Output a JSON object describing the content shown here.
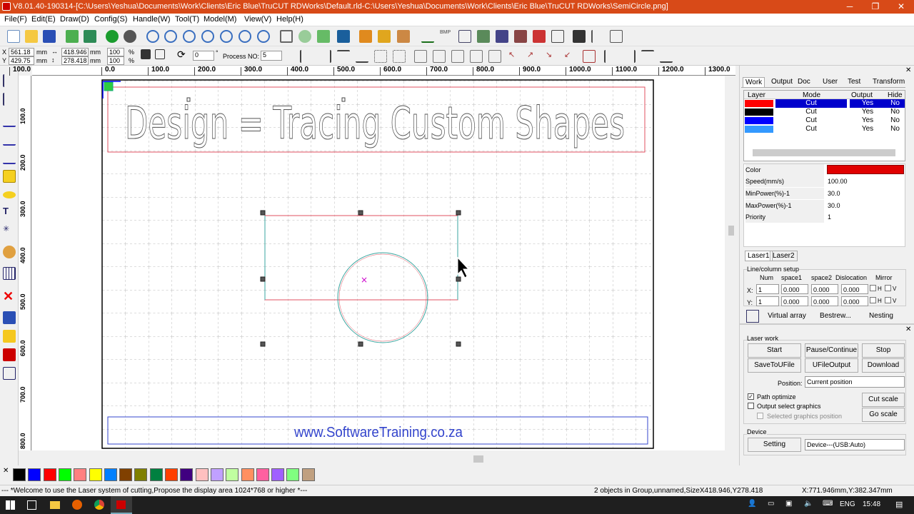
{
  "window": {
    "title": "V8.01.40-190314-[C:\\Users\\Yeshua\\Documents\\Work\\Clients\\Eric Blue\\TruCUT RDWorks\\Default.rld-C:\\Users\\Yeshua\\Documents\\Work\\Clients\\Eric Blue\\TruCUT RDWorks\\SemiCircle.png]",
    "min": "─",
    "max": "❐",
    "close": "✕"
  },
  "menu": [
    "File(F)",
    "Edit(E)",
    "Draw(D)",
    "Config(S)",
    "Handle(W)",
    "Tool(T)",
    "Model(M)",
    "View(V)",
    "Help(H)"
  ],
  "toolbar2": {
    "x_label": "X",
    "y_label": "Y",
    "x_value": "561.18",
    "y_value": "429.75",
    "mm1": "mm",
    "mm2": "mm",
    "w_value": "418.946",
    "h_value": "278.418",
    "mm3": "mm",
    "mm4": "mm",
    "sx": "100",
    "sy": "100",
    "pct1": "%",
    "pct2": "%",
    "rotate": "0",
    "deg": "°",
    "process_label": "Process NO:",
    "process_value": "5"
  },
  "ruler_top": [
    "100.0",
    "0.0",
    "100.0",
    "200.0",
    "300.0",
    "400.0",
    "500.0",
    "600.0",
    "700.0",
    "800.0",
    "900.0",
    "1000.0",
    "1100.0",
    "1200.0",
    "1300.0"
  ],
  "ruler_left": [
    "100.0",
    "200.0",
    "300.0",
    "400.0",
    "500.0",
    "600.0",
    "700.0",
    "800.0"
  ],
  "canvas": {
    "heading": "Design = Tracing Custom Shapes",
    "footer": "www.SoftwareTraining.co.za"
  },
  "palette": [
    "#000000",
    "#0000ff",
    "#ff0000",
    "#00ff00",
    "#ff8080",
    "#ffff00",
    "#0080ff",
    "#804000",
    "#808000",
    "#008040",
    "#ff4000",
    "#400080",
    "#ffc0c0",
    "#c0a0ff",
    "#c0ffa0",
    "#ff9060",
    "#ff60a0",
    "#a060ff",
    "#80ff80",
    "#c0a080"
  ],
  "status": {
    "message": "--- *Welcome to use the Laser system of cutting,Propose the display area 1024*768 or higher *---",
    "selection": "2 objects in Group,unnamed,SizeX418.946,Y278.418",
    "coords": "X:771.946mm,Y:382.347mm"
  },
  "taskbar": {
    "lang": "ENG",
    "time": "15:48"
  },
  "panel": {
    "tabs": [
      "Work",
      "Output",
      "Doc",
      "User",
      "Test",
      "Transform"
    ],
    "layer_headers": [
      "Layer",
      "Mode",
      "Output",
      "Hide"
    ],
    "layers": [
      {
        "color": "#ff0000",
        "mode": "Cut",
        "output": "Yes",
        "hide": "No"
      },
      {
        "color": "#000000",
        "mode": "Cut",
        "output": "Yes",
        "hide": "No"
      },
      {
        "color": "#0000ff",
        "mode": "Cut",
        "output": "Yes",
        "hide": "No"
      },
      {
        "color": "#3399ff",
        "mode": "Cut",
        "output": "Yes",
        "hide": "No"
      }
    ],
    "props": {
      "color_label": "Color",
      "speed_label": "Speed(mm/s)",
      "speed": "100.00",
      "minp_label": "MinPower(%)-1",
      "minp": "30.0",
      "maxp_label": "MaxPower(%)-1",
      "maxp": "30.0",
      "prio_label": "Priority",
      "prio": "1"
    },
    "laser_tabs": [
      "Laser1",
      "Laser2"
    ],
    "array": {
      "group": "Line/column setup",
      "num": "Num",
      "space1": "space1",
      "space2": "space2",
      "dislocation": "Dislocation",
      "mirror": "Mirror",
      "x": "X:",
      "y": "Y:",
      "xnum": "1",
      "ynum": "1",
      "zero": "0.000",
      "h": "H",
      "v": "V",
      "virtual": "Virtual array",
      "bestrew": "Bestrew...",
      "nesting": "Nesting"
    },
    "laserwork": {
      "group": "Laser work",
      "start": "Start",
      "pause": "Pause/Continue",
      "stop": "Stop",
      "save": "SaveToUFile",
      "ufile": "UFileOutput",
      "download": "Download",
      "position_label": "Position:",
      "position": "Current position",
      "path_opt": "Path optimize",
      "output_sel": "Output select graphics",
      "selected_pos": "Selected graphics position",
      "cut_scale": "Cut scale",
      "go_scale": "Go scale"
    },
    "device": {
      "group": "Device",
      "setting": "Setting",
      "value": "Device---(USB:Auto)"
    }
  }
}
